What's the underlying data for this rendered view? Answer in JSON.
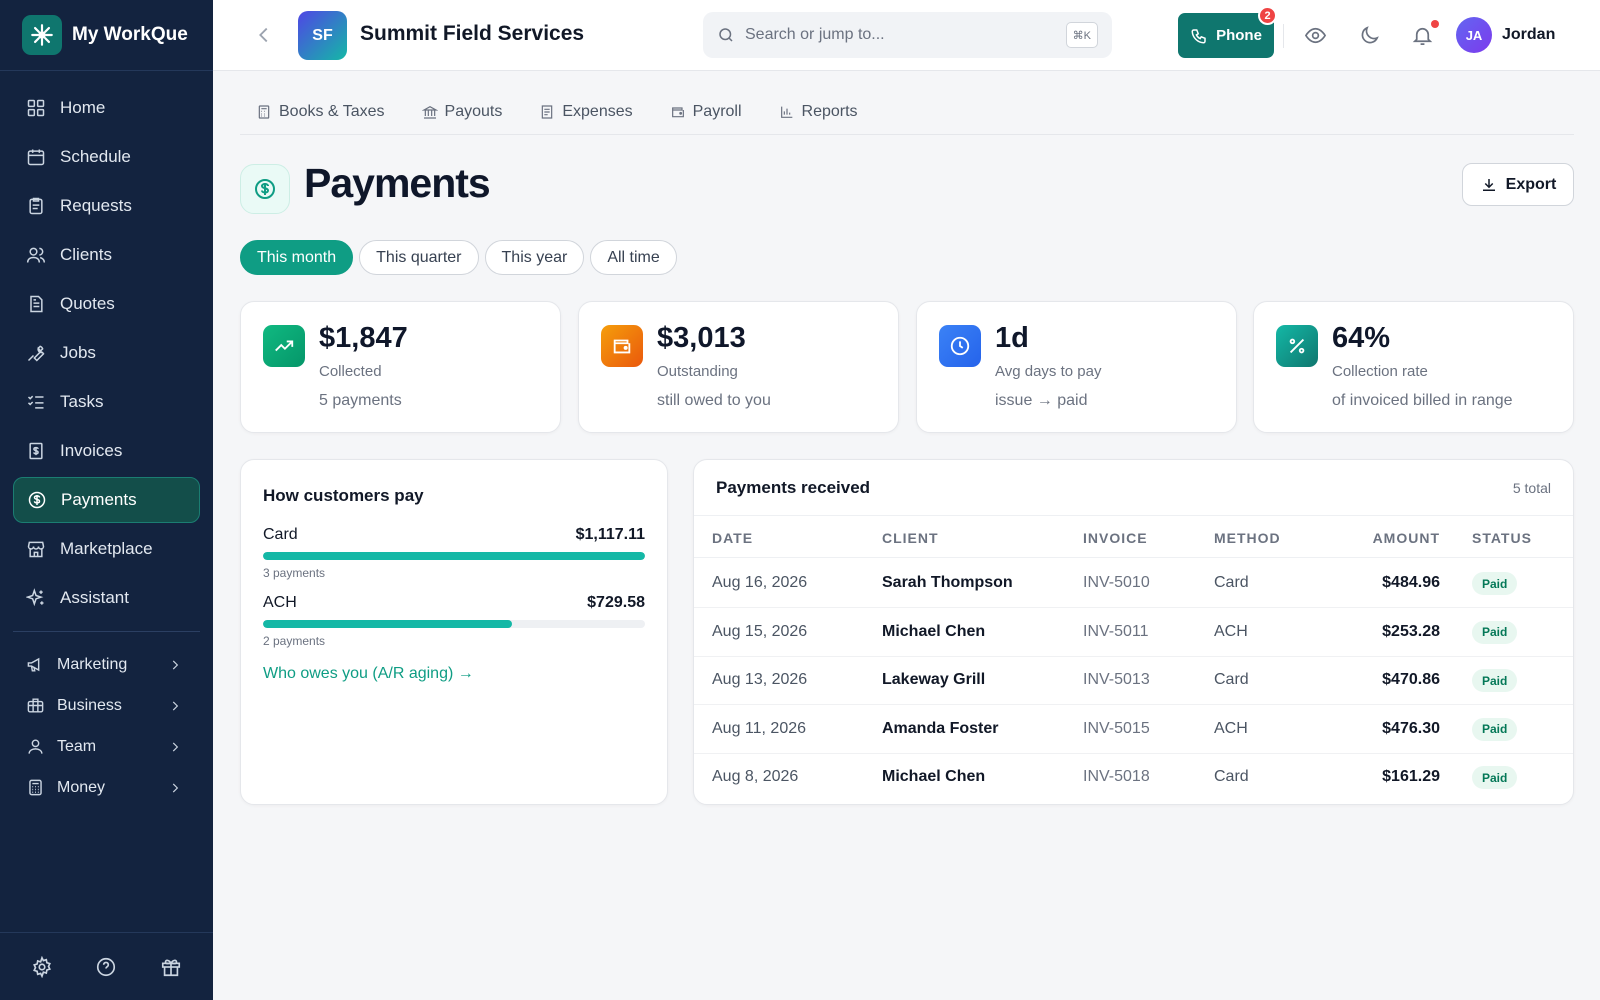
{
  "app": {
    "name": "My WorkQue"
  },
  "sidebar": {
    "items": [
      {
        "label": "Home",
        "icon": "home-icon"
      },
      {
        "label": "Schedule",
        "icon": "calendar-icon"
      },
      {
        "label": "Requests",
        "icon": "clipboard-icon"
      },
      {
        "label": "Clients",
        "icon": "users-icon"
      },
      {
        "label": "Quotes",
        "icon": "document-icon"
      },
      {
        "label": "Jobs",
        "icon": "wrench-icon"
      },
      {
        "label": "Tasks",
        "icon": "checklist-icon"
      },
      {
        "label": "Invoices",
        "icon": "invoice-icon"
      },
      {
        "label": "Payments",
        "icon": "dollar-circle-icon",
        "active": true
      },
      {
        "label": "Marketplace",
        "icon": "store-icon"
      },
      {
        "label": "Assistant",
        "icon": "sparkles-icon"
      }
    ],
    "groups": [
      {
        "label": "Marketing",
        "icon": "megaphone-icon"
      },
      {
        "label": "Business",
        "icon": "briefcase-icon"
      },
      {
        "label": "Team",
        "icon": "user-icon"
      },
      {
        "label": "Money",
        "icon": "calculator-icon"
      }
    ],
    "bottom_icons": [
      "gear-icon",
      "help-icon",
      "gift-icon"
    ]
  },
  "header": {
    "company_initials": "SF",
    "company_name": "Summit Field Services",
    "search_placeholder": "Search or jump to...",
    "search_shortcut": "⌘K",
    "phone_label": "Phone",
    "phone_badge": "2",
    "user_initials": "JA",
    "user_name": "Jordan"
  },
  "subnav": [
    {
      "label": "Books & Taxes",
      "icon": "ledger-icon"
    },
    {
      "label": "Payouts",
      "icon": "bank-icon"
    },
    {
      "label": "Expenses",
      "icon": "receipt-icon"
    },
    {
      "label": "Payroll",
      "icon": "wallet-icon"
    },
    {
      "label": "Reports",
      "icon": "bar-chart-icon"
    }
  ],
  "page": {
    "title": "Payments",
    "export_label": "Export"
  },
  "filters": [
    {
      "label": "This month",
      "active": true
    },
    {
      "label": "This quarter",
      "active": false
    },
    {
      "label": "This year",
      "active": false
    },
    {
      "label": "All time",
      "active": false
    }
  ],
  "stats": [
    {
      "value": "$1,847",
      "label": "Collected",
      "sub": "5 payments",
      "icon": "trending-up-icon",
      "color": "#10b981"
    },
    {
      "value": "$3,013",
      "label": "Outstanding",
      "sub": "still owed to you",
      "icon": "wallet-icon",
      "color": "#f97316"
    },
    {
      "value": "1d",
      "label": "Avg days to pay",
      "sub": "issue → paid",
      "icon": "clock-icon",
      "color": "#3b82f6"
    },
    {
      "value": "64%",
      "label": "Collection rate",
      "sub": "of invoiced billed in range",
      "icon": "percent-icon",
      "color": "#14b8a6"
    }
  ],
  "how_pay": {
    "title": "How customers pay",
    "methods": [
      {
        "name": "Card",
        "amount": "$1,117.11",
        "count": "3 payments",
        "share": 1.0
      },
      {
        "name": "ACH",
        "amount": "$729.58",
        "count": "2 payments",
        "share": 0.653
      }
    ],
    "link": "Who owes you (A/R aging) →"
  },
  "payments": {
    "title": "Payments received",
    "total": "5 total",
    "columns": [
      "DATE",
      "CLIENT",
      "INVOICE",
      "METHOD",
      "AMOUNT",
      "STATUS"
    ],
    "rows": [
      {
        "date": "Aug 16, 2026",
        "client": "Sarah Thompson",
        "invoice": "INV-5010",
        "method": "Card",
        "amount": "$484.96",
        "status": "Paid"
      },
      {
        "date": "Aug 15, 2026",
        "client": "Michael Chen",
        "invoice": "INV-5011",
        "method": "ACH",
        "amount": "$253.28",
        "status": "Paid"
      },
      {
        "date": "Aug 13, 2026",
        "client": "Lakeway Grill",
        "invoice": "INV-5013",
        "method": "Card",
        "amount": "$470.86",
        "status": "Paid"
      },
      {
        "date": "Aug 11, 2026",
        "client": "Amanda Foster",
        "invoice": "INV-5015",
        "method": "ACH",
        "amount": "$476.30",
        "status": "Paid"
      },
      {
        "date": "Aug 8, 2026",
        "client": "Michael Chen",
        "invoice": "INV-5018",
        "method": "Card",
        "amount": "$161.29",
        "status": "Paid"
      }
    ]
  }
}
